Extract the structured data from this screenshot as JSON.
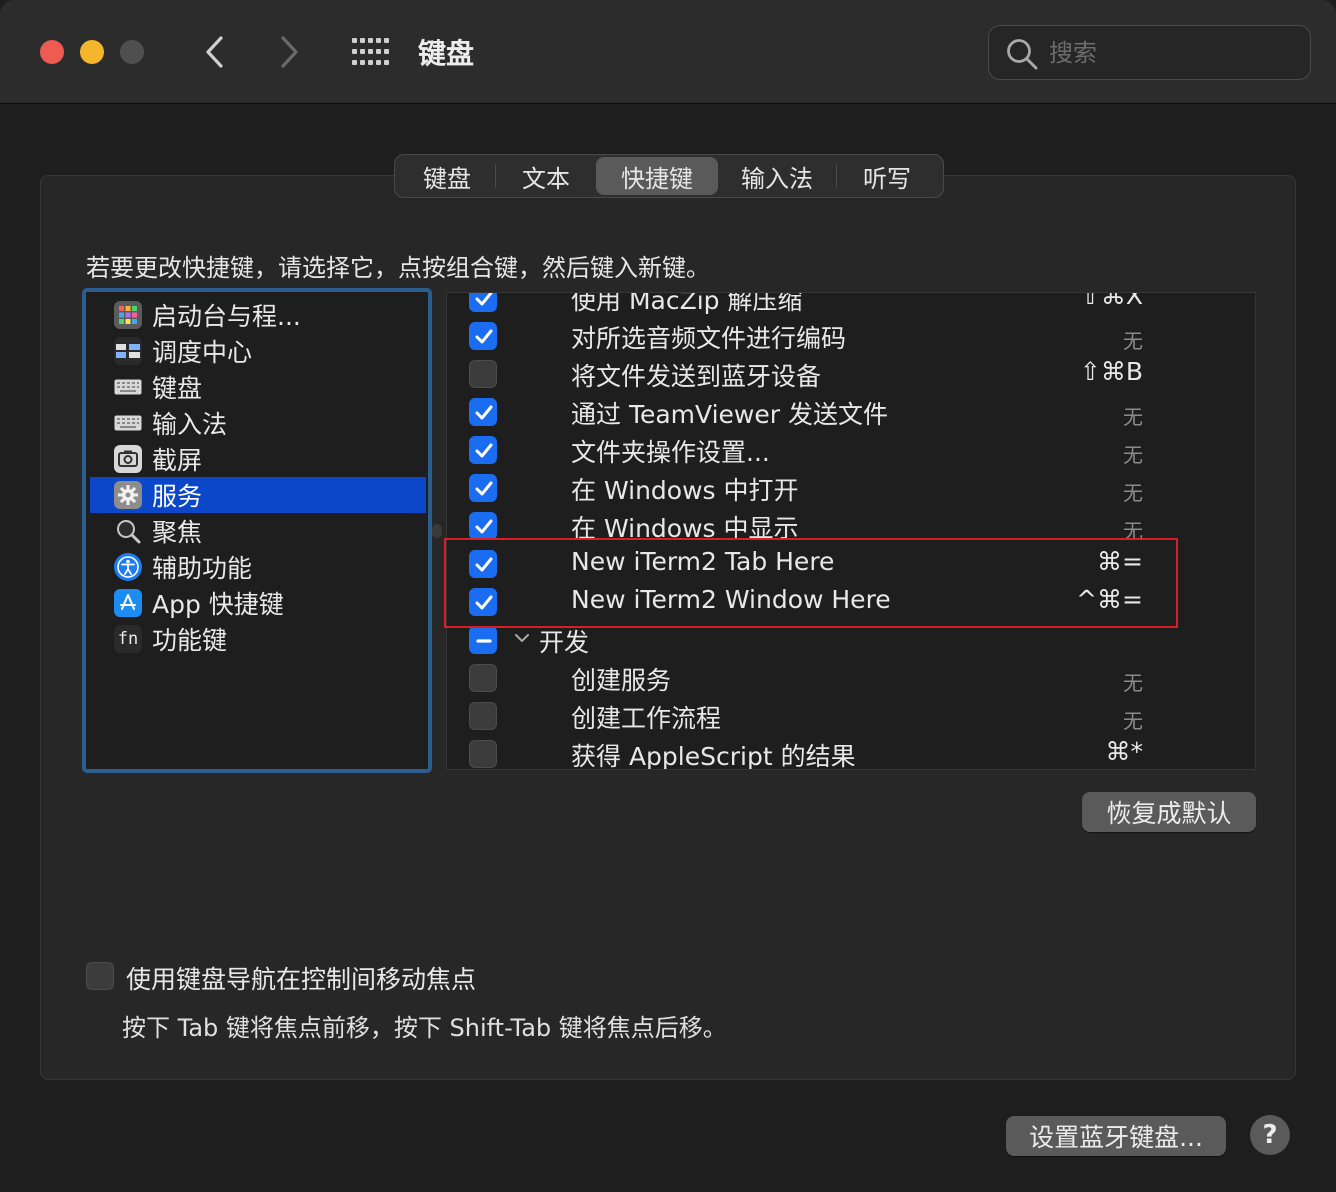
{
  "window": {
    "title": "键盘"
  },
  "search": {
    "placeholder": "搜索"
  },
  "tabs": [
    {
      "label": "键盘",
      "active": false
    },
    {
      "label": "文本",
      "active": false
    },
    {
      "label": "快捷键",
      "active": true
    },
    {
      "label": "输入法",
      "active": false
    },
    {
      "label": "听写",
      "active": false
    }
  ],
  "instructions": "若要更改快捷键，请选择它，点按组合键，然后键入新键。",
  "categories": [
    {
      "label": "启动台与程...",
      "icon": "launchpad-icon",
      "selected": false
    },
    {
      "label": "调度中心",
      "icon": "mission-control-icon",
      "selected": false
    },
    {
      "label": "键盘",
      "icon": "keyboard-icon",
      "selected": false
    },
    {
      "label": "输入法",
      "icon": "input-method-icon",
      "selected": false
    },
    {
      "label": "截屏",
      "icon": "screenshot-icon",
      "selected": false
    },
    {
      "label": "服务",
      "icon": "services-gear-icon",
      "selected": true
    },
    {
      "label": "聚焦",
      "icon": "spotlight-icon",
      "selected": false
    },
    {
      "label": "辅助功能",
      "icon": "accessibility-icon",
      "selected": false
    },
    {
      "label": "App 快捷键",
      "icon": "app-store-icon",
      "selected": false
    },
    {
      "label": "功能键",
      "icon": "fn-key-icon",
      "selected": false
    }
  ],
  "shortcuts": [
    {
      "name": "使用 MacZip 解压缩",
      "key": "⇧⌘X",
      "checked": true,
      "type": "item"
    },
    {
      "name": "对所选音频文件进行编码",
      "key": "无",
      "checked": true,
      "type": "item"
    },
    {
      "name": "将文件发送到蓝牙设备",
      "key": "⇧⌘B",
      "checked": false,
      "type": "item"
    },
    {
      "name": "通过 TeamViewer 发送文件",
      "key": "无",
      "checked": true,
      "type": "item"
    },
    {
      "name": "文件夹操作设置...",
      "key": "无",
      "checked": true,
      "type": "item"
    },
    {
      "name": "在 Windows 中打开",
      "key": "无",
      "checked": true,
      "type": "item"
    },
    {
      "name": "在 Windows 中显示",
      "key": "无",
      "checked": true,
      "type": "item"
    },
    {
      "name": "New iTerm2 Tab Here",
      "key": "⌘=",
      "checked": true,
      "type": "item"
    },
    {
      "name": "New iTerm2 Window Here",
      "key": "^⌘=",
      "checked": true,
      "type": "item"
    },
    {
      "name": "开发",
      "key": "",
      "checked": "mixed",
      "type": "group"
    },
    {
      "name": "创建服务",
      "key": "无",
      "checked": false,
      "type": "item"
    },
    {
      "name": "创建工作流程",
      "key": "无",
      "checked": false,
      "type": "item"
    },
    {
      "name": "获得 AppleScript 的结果",
      "key": "⌘*",
      "checked": false,
      "type": "item"
    }
  ],
  "buttons": {
    "restore_defaults": "恢复成默认",
    "setup_bluetooth": "设置蓝牙键盘...",
    "help": "?"
  },
  "keyboard_navigation": {
    "label": "使用键盘导航在控制间移动焦点",
    "hint": "按下 Tab 键将焦点前移，按下 Shift-Tab 键将焦点后移。",
    "checked": false
  },
  "colors": {
    "accent": "#1a6cf0",
    "selection": "#0d47c9",
    "highlight_box": "#d61f26"
  }
}
